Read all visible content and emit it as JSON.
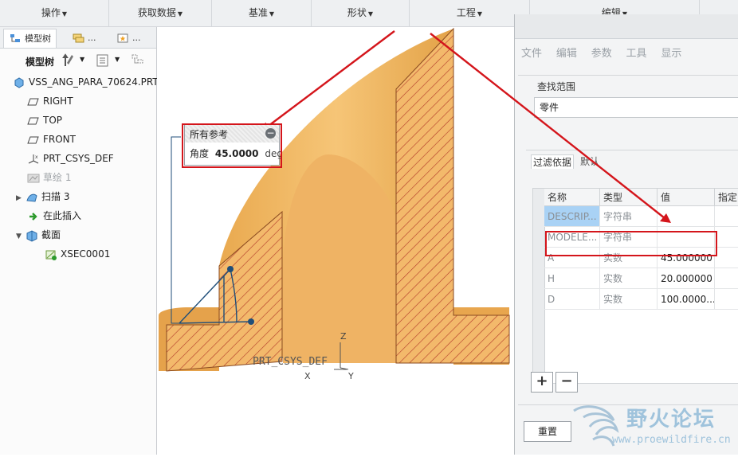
{
  "ribbon": {
    "groups": [
      "操作",
      "获取数据",
      "基准",
      "形状",
      "工程",
      "编辑"
    ]
  },
  "left_panel": {
    "tabs": [
      "模型树",
      "...",
      "..."
    ],
    "toolbar_label": "模型树",
    "tree": [
      {
        "label": "VSS_ANG_PARA_70624.PRT",
        "icon": "part-icon",
        "indent": 0,
        "muted": false
      },
      {
        "label": "RIGHT",
        "icon": "datum-plane-icon",
        "indent": 1,
        "muted": false
      },
      {
        "label": "TOP",
        "icon": "datum-plane-icon",
        "indent": 1,
        "muted": false
      },
      {
        "label": "FRONT",
        "icon": "datum-plane-icon",
        "indent": 1,
        "muted": false
      },
      {
        "label": "PRT_CSYS_DEF",
        "icon": "csys-icon",
        "indent": 1,
        "muted": false
      },
      {
        "label": "草绘 1",
        "icon": "sketch-icon",
        "indent": 1,
        "muted": true
      },
      {
        "label": "扫描 3",
        "icon": "sweep-icon",
        "indent": 1,
        "muted": false,
        "expander": "right"
      },
      {
        "label": "在此插入",
        "icon": "insert-here-icon",
        "indent": 1,
        "muted": false
      },
      {
        "label": "截面",
        "icon": "section-icon",
        "indent": 1,
        "muted": false,
        "expander": "down"
      },
      {
        "label": "XSEC0001",
        "icon": "xsec-icon",
        "indent": 2,
        "muted": false
      }
    ]
  },
  "viewport": {
    "callout": {
      "header": "所有参考",
      "param_label": "角度",
      "param_value": "45.0000",
      "param_unit": "deg"
    },
    "csys_label": "PRT_CSYS_DEF",
    "axis_z": "Z",
    "axis_x": "X",
    "axis_y": "Y"
  },
  "dialog": {
    "menu": [
      "文件",
      "编辑",
      "参数",
      "工具",
      "显示"
    ],
    "scope_label": "查找范围",
    "scope_value": "零件",
    "tabs": [
      "过滤依据",
      "默认"
    ],
    "columns": [
      "名称",
      "类型",
      "值",
      "指定"
    ],
    "rows": [
      {
        "name": "DESCRIP...",
        "type": "字符串",
        "value": "",
        "highlight": true,
        "muted": true
      },
      {
        "name": "MODELE...",
        "type": "字符串",
        "value": "",
        "highlight": false,
        "muted": true
      },
      {
        "name": "A",
        "type": "实数",
        "value": "45.000000",
        "highlight": false,
        "muted": false
      },
      {
        "name": "H",
        "type": "实数",
        "value": "20.000000",
        "highlight": false,
        "muted": false
      },
      {
        "name": "D",
        "type": "实数",
        "value": "100.0000...",
        "highlight": false,
        "muted": false
      }
    ],
    "add_label": "+",
    "remove_label": "−",
    "reset_label": "重置"
  },
  "watermark": {
    "title": "野火论坛",
    "url": "www.proewildfire.cn"
  },
  "colors": {
    "annotation_red": "#d4151b",
    "part_orange": "#f0b45a",
    "hatch": "#c0392b",
    "selection_blue": "#a9d2f5"
  }
}
